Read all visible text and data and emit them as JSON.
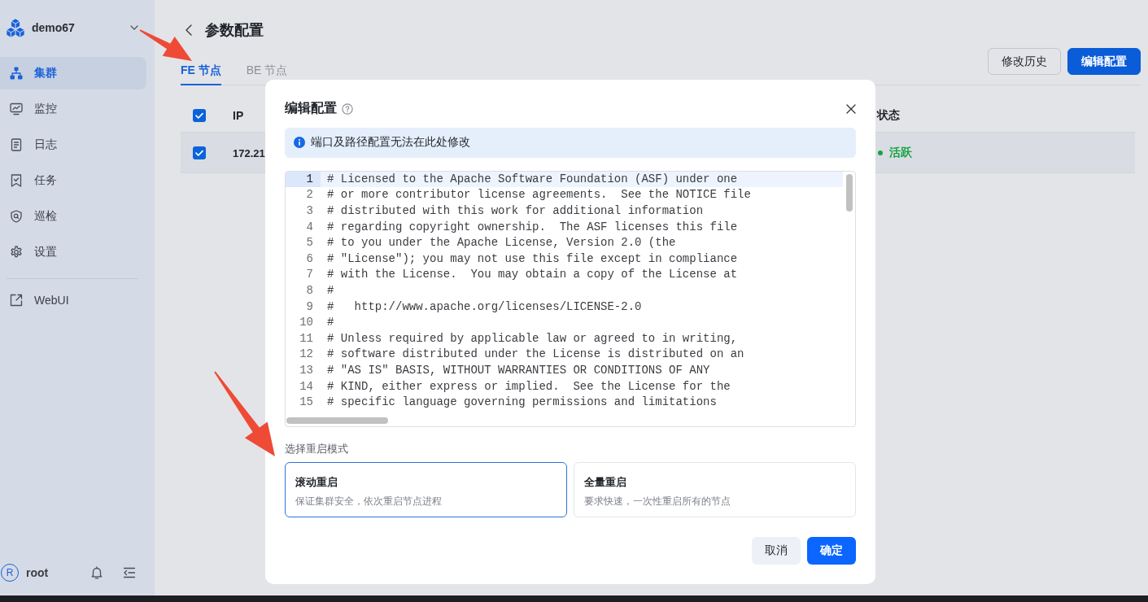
{
  "sidebar": {
    "cluster_name": "demo67",
    "nav": [
      {
        "label": "集群",
        "kind": "cluster",
        "selected": true
      },
      {
        "label": "监控",
        "kind": "monitor",
        "selected": false
      },
      {
        "label": "日志",
        "kind": "log",
        "selected": false
      },
      {
        "label": "任务",
        "kind": "task",
        "selected": false
      },
      {
        "label": "巡检",
        "kind": "inspection",
        "selected": false
      },
      {
        "label": "设置",
        "kind": "settings",
        "selected": false
      }
    ],
    "links": [
      {
        "label": "WebUI",
        "kind": "external"
      }
    ],
    "user": {
      "avatar": "R",
      "name": "root"
    }
  },
  "page": {
    "title": "参数配置",
    "tabs": [
      {
        "label": "FE 节点",
        "selected": true
      },
      {
        "label": "BE 节点",
        "selected": false
      }
    ],
    "actions": [
      {
        "label": "修改历史",
        "kind": "default"
      },
      {
        "label": "编辑配置",
        "kind": "primary"
      }
    ]
  },
  "table": {
    "columns": [
      {
        "label": "IP"
      },
      {
        "label": "状态"
      }
    ],
    "all_checked": true,
    "rows": [
      {
        "checked": true,
        "ip": "172.21",
        "status": {
          "label": "活跃",
          "color": "#17a346"
        }
      }
    ]
  },
  "dialog": {
    "title": "编辑配置",
    "notice": "端口及路径配置无法在此处修改",
    "editor": {
      "lines": [
        {
          "number": "1",
          "text": "# Licensed to the Apache Software Foundation (ASF) under one",
          "highlighted": true
        },
        {
          "number": "2",
          "text": "# or more contributor license agreements.  See the NOTICE file",
          "highlighted": false
        },
        {
          "number": "3",
          "text": "# distributed with this work for additional information",
          "highlighted": false
        },
        {
          "number": "4",
          "text": "# regarding copyright ownership.  The ASF licenses this file",
          "highlighted": false
        },
        {
          "number": "5",
          "text": "# to you under the Apache License, Version 2.0 (the",
          "highlighted": false
        },
        {
          "number": "6",
          "text": "# \"License\"); you may not use this file except in compliance",
          "highlighted": false
        },
        {
          "number": "7",
          "text": "# with the License.  You may obtain a copy of the License at",
          "highlighted": false
        },
        {
          "number": "8",
          "text": "#",
          "highlighted": false
        },
        {
          "number": "9",
          "text": "#   http://www.apache.org/licenses/LICENSE-2.0",
          "highlighted": false
        },
        {
          "number": "10",
          "text": "#",
          "highlighted": false
        },
        {
          "number": "11",
          "text": "# Unless required by applicable law or agreed to in writing,",
          "highlighted": false
        },
        {
          "number": "12",
          "text": "# software distributed under the License is distributed on an",
          "highlighted": false
        },
        {
          "number": "13",
          "text": "# \"AS IS\" BASIS, WITHOUT WARRANTIES OR CONDITIONS OF ANY",
          "highlighted": false
        },
        {
          "number": "14",
          "text": "# KIND, either express or implied.  See the License for the",
          "highlighted": false
        },
        {
          "number": "15",
          "text": "# specific language governing permissions and limitations",
          "highlighted": false
        }
      ]
    },
    "restart_label": "选择重启模式",
    "restart_modes": [
      {
        "title": "滚动重启",
        "description": "保证集群安全，依次重启节点进程",
        "selected": true
      },
      {
        "title": "全量重启",
        "description": "要求快速，一次性重启所有的节点",
        "selected": false
      }
    ],
    "buttons": [
      {
        "label": "取消",
        "kind": "default"
      },
      {
        "label": "确定",
        "kind": "primary"
      }
    ]
  }
}
